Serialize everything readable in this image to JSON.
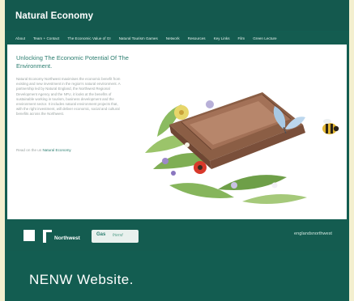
{
  "site": {
    "logo_text": "Natural Economy"
  },
  "nav": {
    "items": [
      "About",
      "Team + Contact",
      "The Economic Value of GI",
      "Natural Tourism Games",
      "Network",
      "Resources",
      "Key Links",
      "Film",
      "Green Lecture"
    ]
  },
  "main": {
    "heading": "Unlocking The Economic Potential Of The Environment.",
    "body": "Natural Economy Northwest maximises the economic benefit from existing and new investment in the region's natural environment. A partnership led by Natural England, the Northwest Regional Development Agency and the NFU, it looks at the benefits of sustainable working in tourism, business development and the environment sector. It includes natural environment projects that, with the right investment, will deliver economic, social and cultural benefits across the Northwest.",
    "readmore_prefix": "Read on the us",
    "readmore_link": "Natural Economy"
  },
  "footer": {
    "logo2_text": "Northwest",
    "logo3_text": "Gas",
    "logo3_subtext": "friend",
    "logo4_text": "englandsnorthwest"
  },
  "caption": "NENW Website.",
  "colors": {
    "page_bg": "#f3efcf",
    "frame": "#135d51",
    "accent_text": "#2c7e70"
  }
}
